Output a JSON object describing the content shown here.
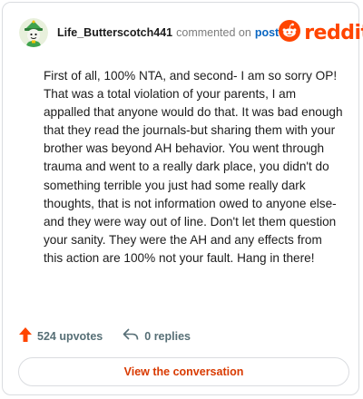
{
  "header": {
    "username": "Life_Butterscotch441",
    "action_text": "commented on",
    "post_link": "post",
    "logo_text": "reddit"
  },
  "comment": {
    "body": "First of all, 100% NTA, and second- I am so sorry OP! That was a total violation of your parents, I am appalled that anyone would do that. It was bad enough that they read the journals-but sharing them with your brother was beyond AH behavior. You went through trauma and went to a really dark place, you didn't do something terrible you just had some really dark thoughts, that is not information owed to anyone else- and they were way out of line. Don't let them question your sanity. They were the AH and any effects from this action are 100% not your fault. Hang in there!"
  },
  "stats": {
    "upvotes": "524 upvotes",
    "replies": "0 replies"
  },
  "footer": {
    "view_button": "View the conversation"
  },
  "colors": {
    "brand": "#ff4500",
    "link": "#0a66c2",
    "button_text": "#d93a00",
    "muted": "#576f76"
  },
  "icons": [
    "avatar",
    "reddit-snoo-icon",
    "upvote-arrow-icon",
    "reply-arrow-icon"
  ]
}
